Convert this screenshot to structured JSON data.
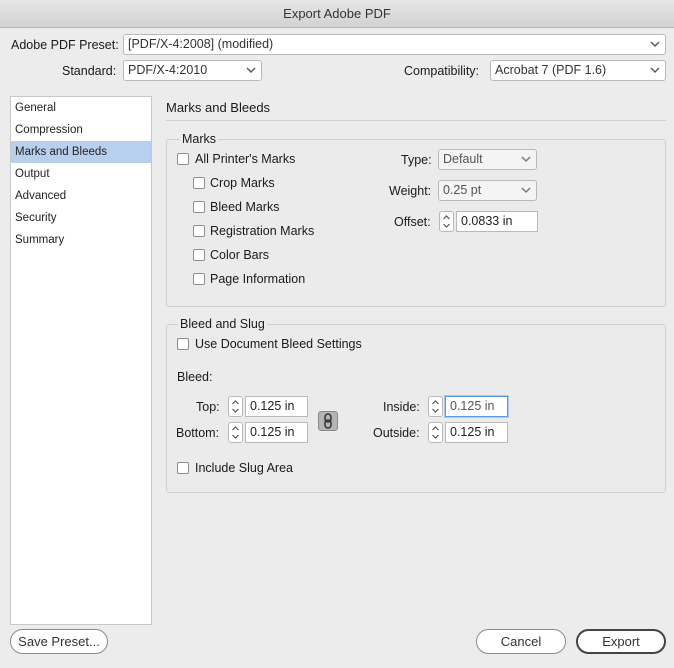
{
  "window": {
    "title": "Export Adobe PDF"
  },
  "preset": {
    "label": "Adobe PDF Preset:",
    "value": "[PDF/X-4:2008] (modified)"
  },
  "standard": {
    "label": "Standard:",
    "value": "PDF/X-4:2010"
  },
  "compatibility": {
    "label": "Compatibility:",
    "value": "Acrobat 7 (PDF 1.6)"
  },
  "sidebar": {
    "items": [
      {
        "label": "General"
      },
      {
        "label": "Compression"
      },
      {
        "label": "Marks and Bleeds",
        "selected": true
      },
      {
        "label": "Output"
      },
      {
        "label": "Advanced"
      },
      {
        "label": "Security"
      },
      {
        "label": "Summary"
      }
    ]
  },
  "panel": {
    "title": "Marks and Bleeds"
  },
  "marks": {
    "title": "Marks",
    "all_printers": "All Printer's Marks",
    "crop": "Crop Marks",
    "bleed": "Bleed Marks",
    "registration": "Registration Marks",
    "color_bars": "Color Bars",
    "page_info": "Page Information",
    "type_label": "Type:",
    "type_value": "Default",
    "weight_label": "Weight:",
    "weight_value": "0.25 pt",
    "offset_label": "Offset:",
    "offset_value": "0.0833 in"
  },
  "bleed_slug": {
    "title": "Bleed and Slug",
    "use_doc": "Use Document Bleed Settings",
    "bleed_label": "Bleed:",
    "top_label": "Top:",
    "top_value": "0.125 in",
    "bottom_label": "Bottom:",
    "bottom_value": "0.125 in",
    "inside_label": "Inside:",
    "inside_value": "0.125 in",
    "outside_label": "Outside:",
    "outside_value": "0.125 in",
    "include_slug": "Include Slug Area"
  },
  "buttons": {
    "save_preset": "Save Preset...",
    "cancel": "Cancel",
    "export": "Export"
  },
  "colors": {
    "selection": "#b8d0ee",
    "focus": "#5b9ae5"
  }
}
